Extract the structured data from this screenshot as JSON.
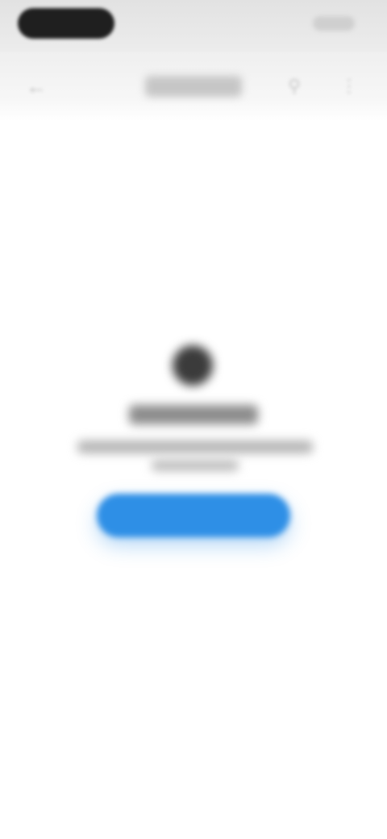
{
  "colors": {
    "status_bar_bg": "#e6e6e6",
    "status_pill": "#1f1f1f",
    "toolbar_bg": "#f2f2f2",
    "page_bg": "#ffffff",
    "empty_icon": "#3b3b3b",
    "primary_button": "#2e8fe6"
  },
  "status_bar": {
    "time_label": "",
    "indicators_label": ""
  },
  "toolbar": {
    "back_icon": "back-arrow-icon",
    "title": "",
    "search_icon": "search-icon",
    "more_icon": "more-icon"
  },
  "empty_state": {
    "icon": "placeholder-icon",
    "title": "",
    "description_line1": "",
    "description_line2": "",
    "button_label": ""
  }
}
